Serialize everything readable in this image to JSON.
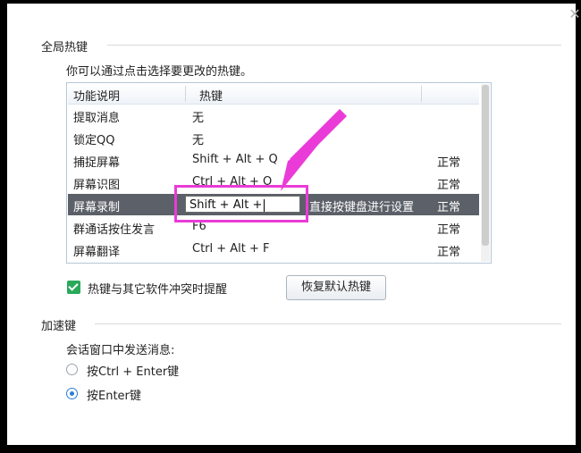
{
  "global_hotkeys": {
    "title": "全局热键",
    "hint": "你可以通过点击选择要更改的热键。",
    "columns": {
      "function": "功能说明",
      "hotkey": "热键"
    },
    "rows": [
      {
        "function": "提取消息",
        "hotkey": "无",
        "status": ""
      },
      {
        "function": "锁定QQ",
        "hotkey": "无",
        "status": ""
      },
      {
        "function": "捕捉屏幕",
        "hotkey": "Shift + Alt + Q",
        "status": "正常"
      },
      {
        "function": "屏幕识图",
        "hotkey": "Ctrl + Alt + O",
        "status": "正常"
      },
      {
        "function": "屏幕录制",
        "hotkey": "Shift + Alt +",
        "status": "正常",
        "tip": "直接按键盘进行设置",
        "selected": true
      },
      {
        "function": "群通话按住发言",
        "hotkey": "F6",
        "status": "正常"
      },
      {
        "function": "屏幕翻译",
        "hotkey": "Ctrl + Alt + F",
        "status": "正常"
      }
    ],
    "conflict_checkbox": {
      "label": "热键与其它软件冲突时提醒",
      "checked": true
    },
    "restore_button": "恢复默认热键"
  },
  "accelerators": {
    "title": "加速键",
    "send_label": "会话窗口中发送消息:",
    "options": [
      {
        "label": "按Ctrl + Enter键",
        "selected": false
      },
      {
        "label": "按Enter键",
        "selected": true
      }
    ]
  },
  "colors": {
    "highlight": "#ea3bd8",
    "selected_row": "#5c6068",
    "check": "#2aa95b",
    "radio": "#2d7fd3"
  }
}
